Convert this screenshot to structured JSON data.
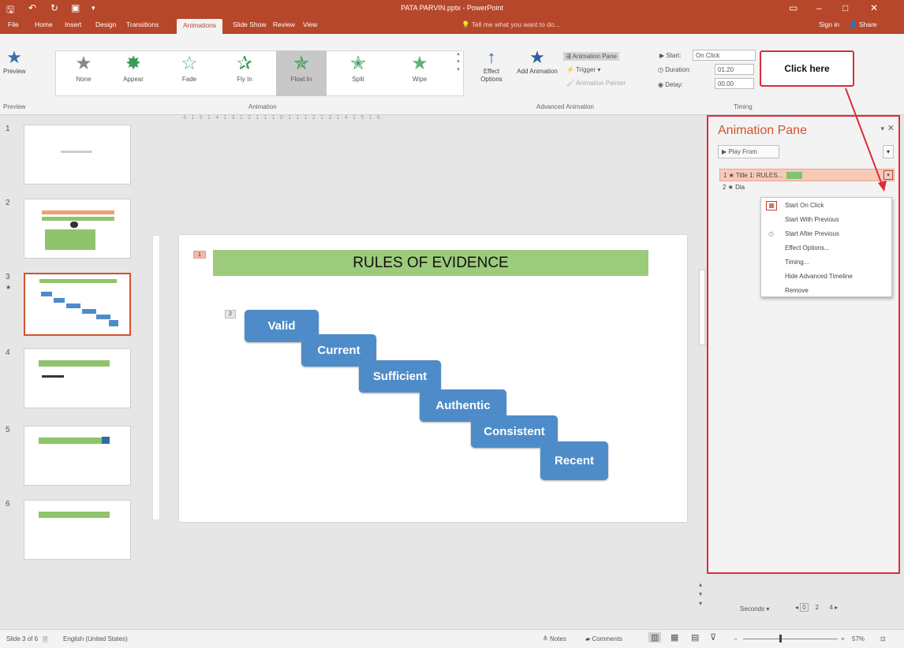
{
  "window": {
    "title": "PATA PARVIN.pptx - PowerPoint",
    "sign_in": "Sign in",
    "share": "Share"
  },
  "tabs": [
    {
      "label": "File"
    },
    {
      "label": "Home"
    },
    {
      "label": "Insert"
    },
    {
      "label": "Design"
    },
    {
      "label": "Transitions"
    },
    {
      "label": "Animations"
    },
    {
      "label": "Slide Show"
    },
    {
      "label": "Review"
    },
    {
      "label": "View"
    }
  ],
  "tell_me": "Tell me what you want to do...",
  "ribbon": {
    "preview": "Preview",
    "animations": [
      {
        "label": "None"
      },
      {
        "label": "Appear"
      },
      {
        "label": "Fade"
      },
      {
        "label": "Fly In"
      },
      {
        "label": "Float In"
      },
      {
        "label": "Split"
      },
      {
        "label": "Wipe"
      }
    ],
    "effect_options": "Effect Options",
    "add_animation": "Add Animation",
    "animation_pane": "Animation Pane",
    "trigger": "Trigger",
    "animation_painter": "Animation Painter",
    "start_label": "Start:",
    "start_value": "On Click",
    "duration_label": "Duration:",
    "duration_value": "01.20",
    "delay_label": "Delay:",
    "delay_value": "00.00",
    "group_preview": "Preview",
    "group_animation": "Animation",
    "group_advanced": "Advanced Animation",
    "group_timing": "Timing"
  },
  "callout": "Click here",
  "thumbnails": [
    {
      "num": "1"
    },
    {
      "num": "2"
    },
    {
      "num": "3"
    },
    {
      "num": "4"
    },
    {
      "num": "5"
    },
    {
      "num": "6"
    }
  ],
  "slide": {
    "title": "RULES OF EVIDENCE",
    "title_tag": "1",
    "steps_tag": "2",
    "steps": [
      "Valid",
      "Current",
      "Sufficient",
      "Authentic",
      "Consistent",
      "Recent"
    ]
  },
  "animation_pane": {
    "title": "Animation Pane",
    "play_from": "Play From",
    "items": [
      {
        "text": "1 ★ Title 1: RULES..."
      },
      {
        "text": "2 ★ Dia"
      }
    ],
    "menu": [
      "Start On Click",
      "Start With Previous",
      "Start After Previous",
      "Effect Options...",
      "Timing...",
      "Hide Advanced Timeline",
      "Remove"
    ],
    "seconds": "Seconds",
    "timeline": [
      "0",
      "2",
      "4"
    ]
  },
  "status": {
    "slide_of": "Slide 3 of 6",
    "language": "English (United States)",
    "notes": "Notes",
    "comments": "Comments",
    "zoom": "57%"
  },
  "colors": {
    "accent": "#b7472a",
    "highlight": "#d92d3a",
    "smartart": "#4e8cc9",
    "title_fill": "#9ccb7c"
  }
}
